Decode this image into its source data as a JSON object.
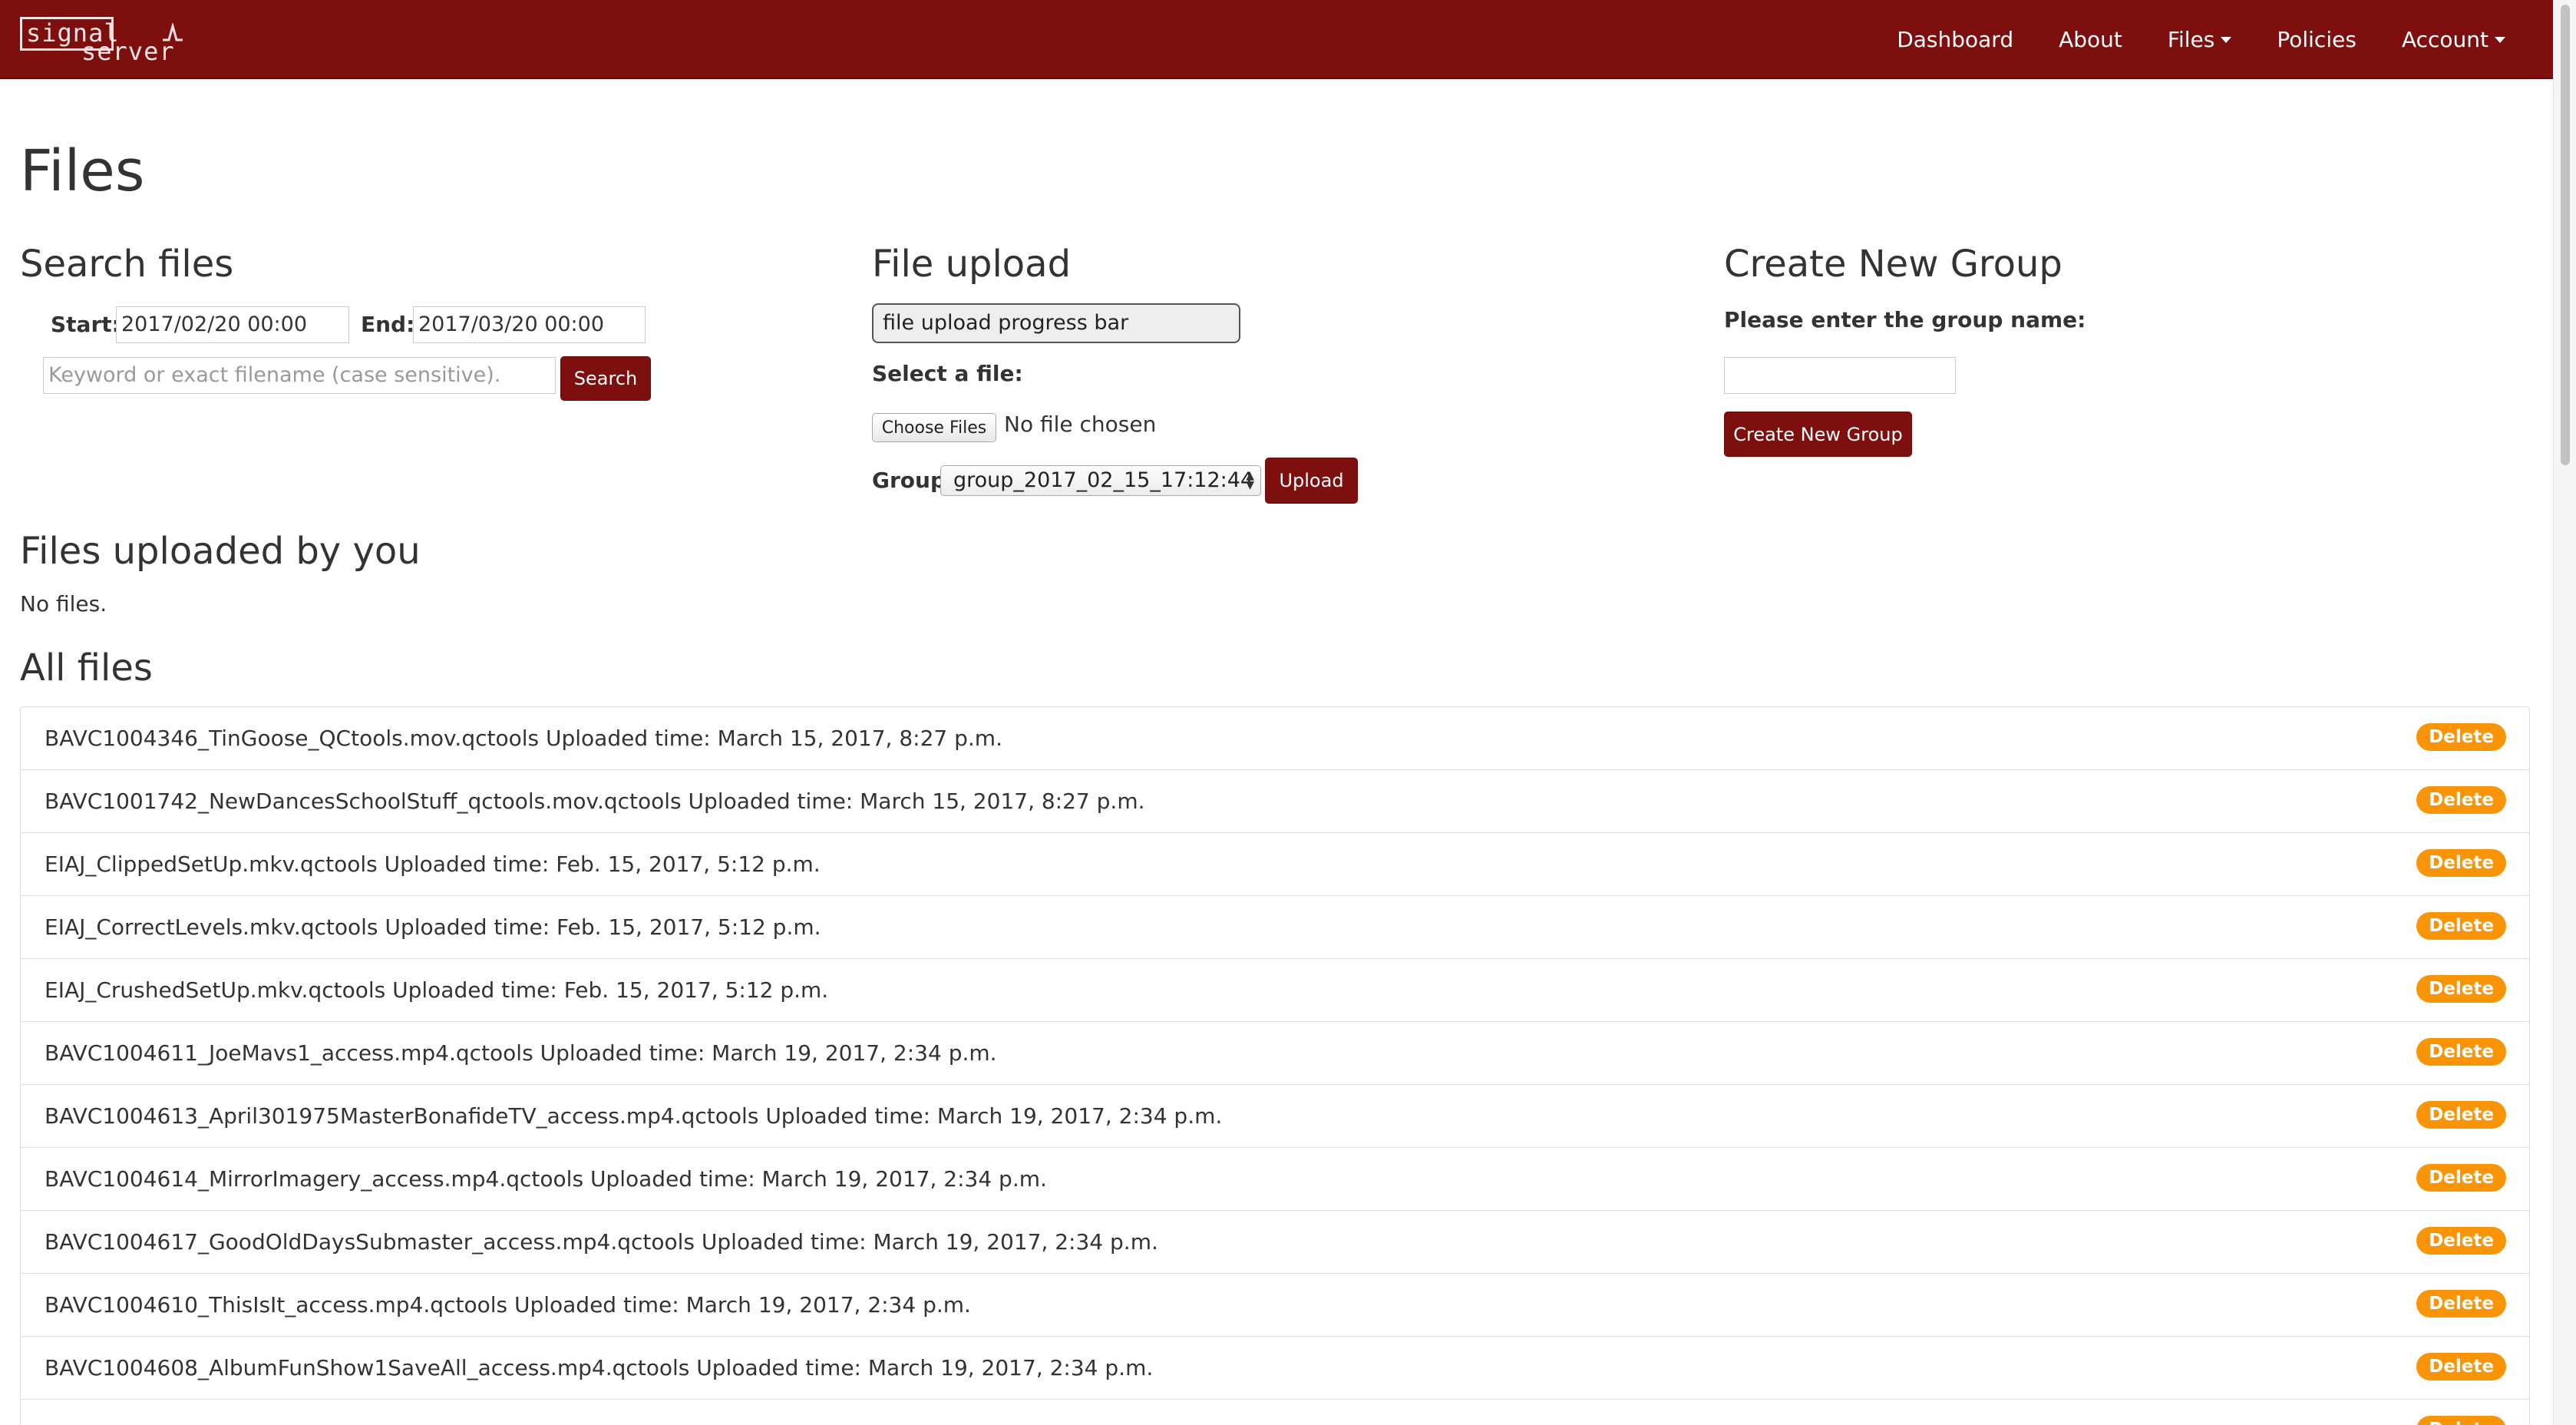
{
  "brand": {
    "line1": "signal",
    "line2": "server"
  },
  "nav": {
    "items": [
      {
        "label": "Dashboard",
        "dropdown": false
      },
      {
        "label": "About",
        "dropdown": false
      },
      {
        "label": "Files",
        "dropdown": true
      },
      {
        "label": "Policies",
        "dropdown": false
      },
      {
        "label": "Account",
        "dropdown": true
      }
    ]
  },
  "page": {
    "title": "Files"
  },
  "search": {
    "heading": "Search files",
    "start_label": "Start:",
    "start_value": "2017/02/20 00:00",
    "end_label": "End:",
    "end_value": "2017/03/20 00:00",
    "keyword_placeholder": "Keyword or exact filename (case sensitive).",
    "search_button": "Search"
  },
  "upload": {
    "heading": "File upload",
    "progress_text": "file upload progress bar",
    "progress_value": 0,
    "select_label": "Select a file:",
    "choose_button": "Choose Files",
    "no_file_text": "No file chosen",
    "group_label": "Group",
    "group_selected": "group_2017_02_15_17:12:44",
    "upload_button": "Upload"
  },
  "group": {
    "heading": "Create New Group",
    "prompt": "Please enter the group name:",
    "name_value": "",
    "create_button": "Create New Group"
  },
  "my_files": {
    "heading": "Files uploaded by you",
    "empty_text": "No files."
  },
  "all_files": {
    "heading": "All files",
    "delete_label": "Delete",
    "items": [
      {
        "text": "BAVC1004346_TinGoose_QCtools.mov.qctools Uploaded time: March 15, 2017, 8:27 p.m."
      },
      {
        "text": "BAVC1001742_NewDancesSchoolStuff_qctools.mov.qctools Uploaded time: March 15, 2017, 8:27 p.m."
      },
      {
        "text": "EIAJ_ClippedSetUp.mkv.qctools Uploaded time: Feb. 15, 2017, 5:12 p.m."
      },
      {
        "text": "EIAJ_CorrectLevels.mkv.qctools Uploaded time: Feb. 15, 2017, 5:12 p.m."
      },
      {
        "text": "EIAJ_CrushedSetUp.mkv.qctools Uploaded time: Feb. 15, 2017, 5:12 p.m."
      },
      {
        "text": "BAVC1004611_JoeMavs1_access.mp4.qctools Uploaded time: March 19, 2017, 2:34 p.m."
      },
      {
        "text": "BAVC1004613_April301975MasterBonafideTV_access.mp4.qctools Uploaded time: March 19, 2017, 2:34 p.m."
      },
      {
        "text": "BAVC1004614_MirrorImagery_access.mp4.qctools Uploaded time: March 19, 2017, 2:34 p.m."
      },
      {
        "text": "BAVC1004617_GoodOldDaysSubmaster_access.mp4.qctools Uploaded time: March 19, 2017, 2:34 p.m."
      },
      {
        "text": "BAVC1004610_ThisIsIt_access.mp4.qctools Uploaded time: March 19, 2017, 2:34 p.m."
      },
      {
        "text": "BAVC1004608_AlbumFunShow1SaveAll_access.mp4.qctools Uploaded time: March 19, 2017, 2:34 p.m."
      },
      {
        "text": ""
      }
    ]
  },
  "colors": {
    "brand": "#7e0f0f",
    "badge": "#f89406"
  }
}
